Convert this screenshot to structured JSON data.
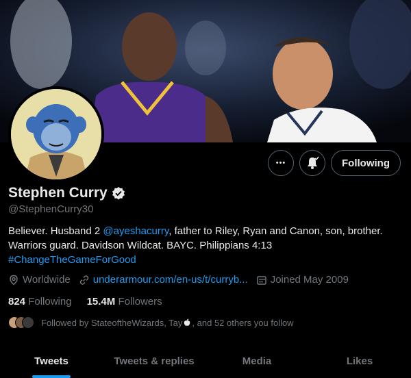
{
  "profile": {
    "name": "Stephen Curry",
    "handle": "@StephenCurry30",
    "verified_color": "#e7e9ea",
    "avatar_bg": "#e8dfa8"
  },
  "actions": {
    "more_label": "•••",
    "notify_icon": "bell-plus-icon",
    "following_label": "Following"
  },
  "bio": {
    "part1": "Believer. Husband 2 ",
    "mention": "@ayeshacurry",
    "part2": ", father to Riley, Ryan and Canon, son, brother. Warriors guard. Davidson Wildcat. BAYC. Philippians 4:13",
    "hashtag": "#ChangeTheGameForGood"
  },
  "meta": {
    "location": "Worldwide",
    "website": "underarmour.com/en-us/t/curryb...",
    "joined": "Joined May 2009"
  },
  "counts": {
    "following_num": "824",
    "following_label": "Following",
    "followers_num": "15.4M",
    "followers_label": "Followers"
  },
  "followed_by": {
    "text": "Followed by StateoftheWizards, Tay",
    "suffix": ", and 52 others you follow"
  },
  "tabs": [
    {
      "label": "Tweets",
      "active": true
    },
    {
      "label": "Tweets & replies",
      "active": false
    },
    {
      "label": "Media",
      "active": false
    },
    {
      "label": "Likes",
      "active": false
    }
  ],
  "colors": {
    "accent": "#1d9bf0",
    "text_primary": "#e7e9ea",
    "text_secondary": "#71767b",
    "background": "#000000"
  }
}
